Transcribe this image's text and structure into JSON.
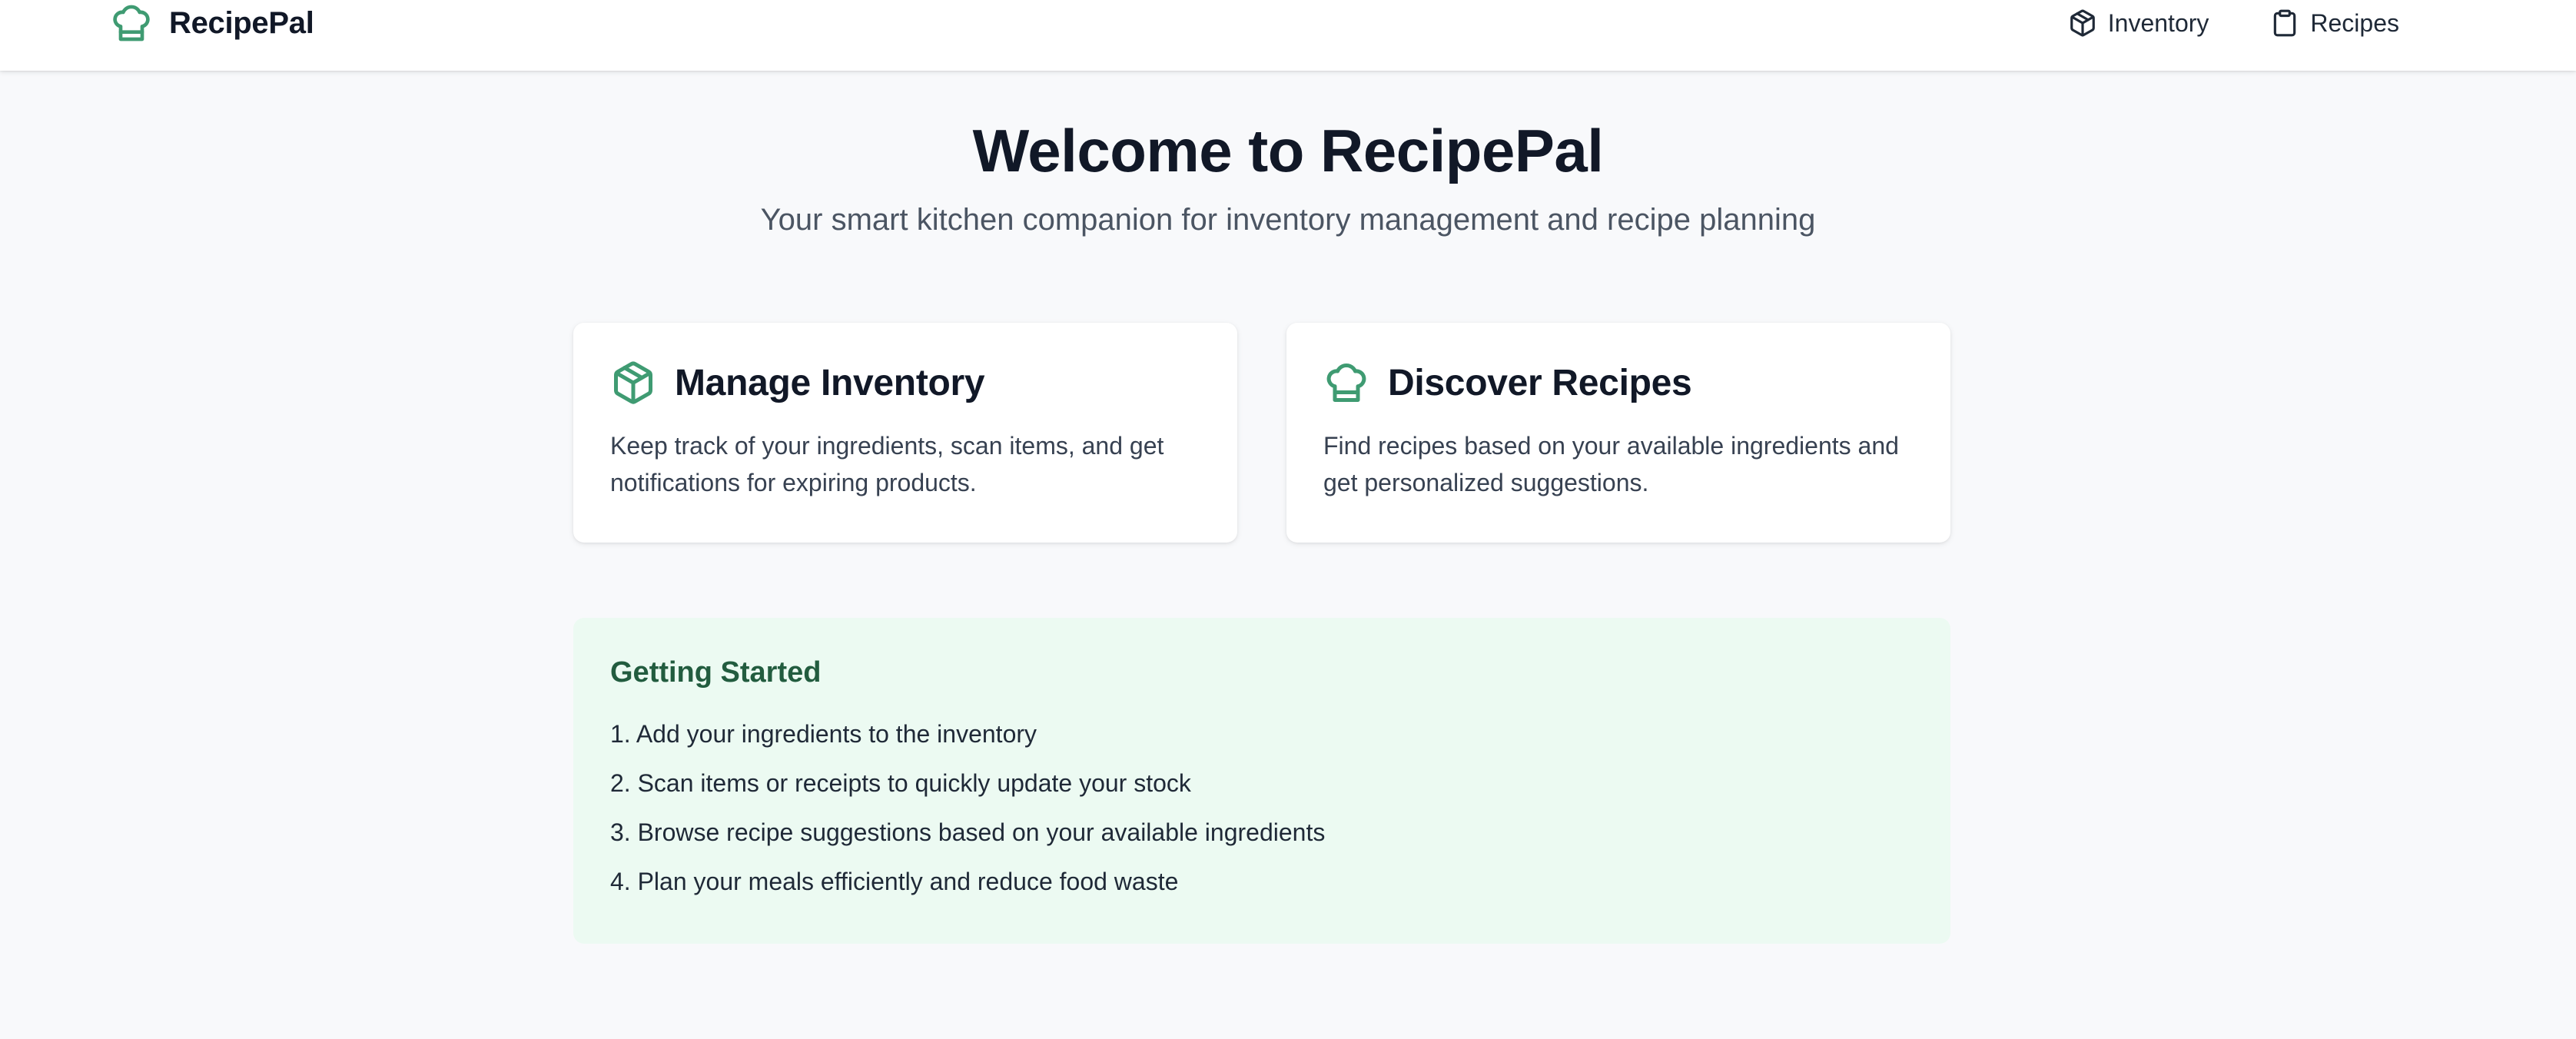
{
  "colors": {
    "accent": "#3f9b72",
    "page_bg": "#f8f9fb",
    "getting_started_bg": "#ecfaf2",
    "getting_started_title": "#225c3f"
  },
  "header": {
    "brand": {
      "icon": "chef-hat-icon",
      "name": "RecipePal"
    },
    "nav": [
      {
        "icon": "package-icon",
        "label": "Inventory"
      },
      {
        "icon": "clipboard-icon",
        "label": "Recipes"
      }
    ]
  },
  "hero": {
    "title": "Welcome to RecipePal",
    "subtitle": "Your smart kitchen companion for inventory management and recipe planning"
  },
  "features": [
    {
      "icon": "package-icon",
      "title": "Manage Inventory",
      "description": "Keep track of your ingredients, scan items, and get notifications for expiring products."
    },
    {
      "icon": "chef-hat-icon",
      "title": "Discover Recipes",
      "description": "Find recipes based on your available ingredients and get personalized suggestions."
    }
  ],
  "getting_started": {
    "title": "Getting Started",
    "steps": [
      "1. Add your ingredients to the inventory",
      "2. Scan items or receipts to quickly update your stock",
      "3. Browse recipe suggestions based on your available ingredients",
      "4. Plan your meals efficiently and reduce food waste"
    ]
  }
}
